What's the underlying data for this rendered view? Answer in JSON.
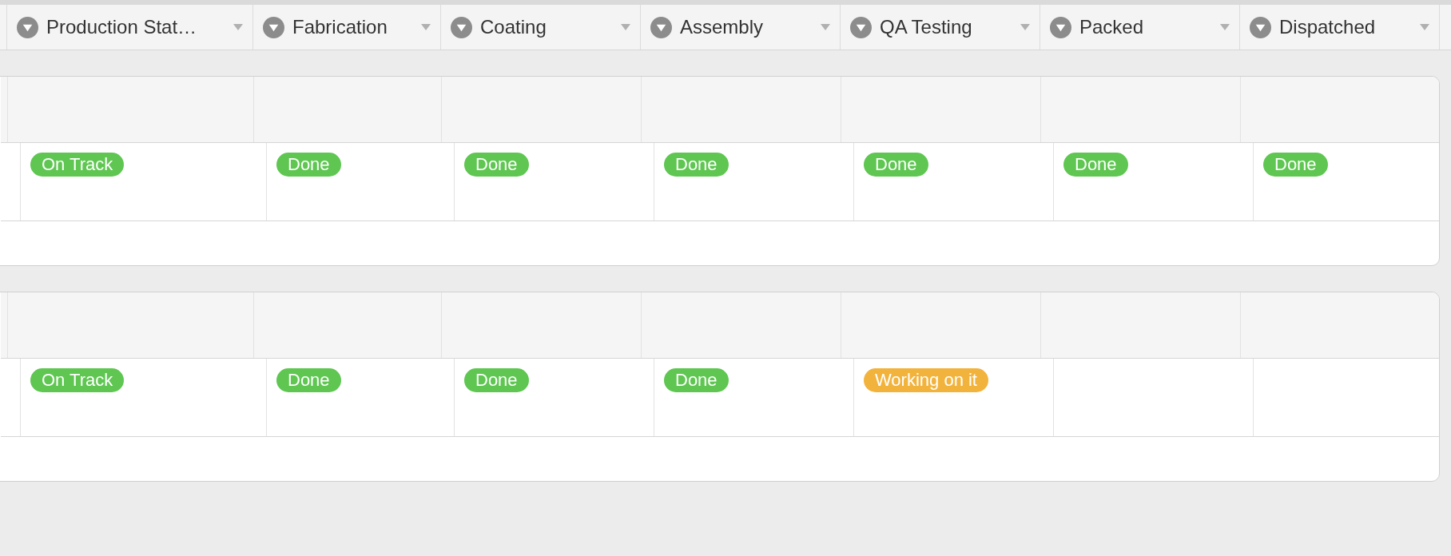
{
  "columns": [
    {
      "label": "Production Stat…"
    },
    {
      "label": "Fabrication"
    },
    {
      "label": "Coating"
    },
    {
      "label": "Assembly"
    },
    {
      "label": "QA Testing"
    },
    {
      "label": "Packed"
    },
    {
      "label": "Dispatched"
    }
  ],
  "groups": [
    {
      "rows": [
        {
          "cells": [
            {
              "label": "On Track",
              "color": "#5ec651"
            },
            {
              "label": "Done",
              "color": "#5ec651"
            },
            {
              "label": "Done",
              "color": "#5ec651"
            },
            {
              "label": "Done",
              "color": "#5ec651"
            },
            {
              "label": "Done",
              "color": "#5ec651"
            },
            {
              "label": "Done",
              "color": "#5ec651"
            },
            {
              "label": "Done",
              "color": "#5ec651"
            }
          ]
        }
      ]
    },
    {
      "rows": [
        {
          "cells": [
            {
              "label": "On Track",
              "color": "#5ec651"
            },
            {
              "label": "Done",
              "color": "#5ec651"
            },
            {
              "label": "Done",
              "color": "#5ec651"
            },
            {
              "label": "Done",
              "color": "#5ec651"
            },
            {
              "label": "Working on it",
              "color": "#f2b33d"
            },
            null,
            null
          ]
        }
      ]
    }
  ]
}
